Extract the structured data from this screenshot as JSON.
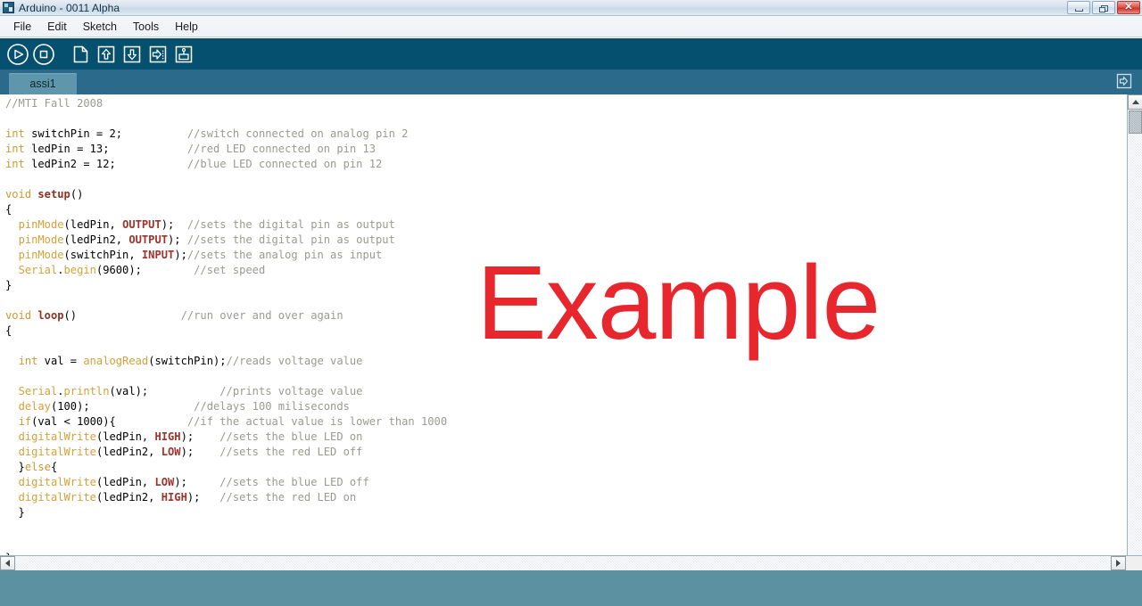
{
  "window": {
    "title": "Arduino - 0011 Alpha",
    "app_icon": "arduino-app-icon",
    "buttons": {
      "minimize": "minimize-button",
      "maximize": "restore-button",
      "close_glyph": "✕"
    }
  },
  "menubar": {
    "items": [
      {
        "label": "File"
      },
      {
        "label": "Edit"
      },
      {
        "label": "Sketch"
      },
      {
        "label": "Tools"
      },
      {
        "label": "Help"
      }
    ]
  },
  "toolbar": {
    "buttons": [
      {
        "name": "verify-run-button",
        "icon": "play-circle-icon"
      },
      {
        "name": "stop-button",
        "icon": "stop-circle-icon"
      },
      {
        "name": "new-button",
        "icon": "new-file-icon"
      },
      {
        "name": "open-button",
        "icon": "arrow-up-box-icon"
      },
      {
        "name": "save-button",
        "icon": "arrow-down-box-icon"
      },
      {
        "name": "upload-button",
        "icon": "arrow-right-dots-icon"
      },
      {
        "name": "serial-monitor-button",
        "icon": "serial-monitor-icon"
      }
    ]
  },
  "tabbar": {
    "tabs": [
      {
        "label": "assi1",
        "active": true
      }
    ],
    "menu_button": "tab-menu-icon"
  },
  "editor": {
    "watermark": {
      "text": "Example",
      "color": "#e8262d"
    },
    "colors": {
      "comment": "#9a9a92",
      "keyword": "#cc9a33",
      "function": "#d4a13a",
      "constant": "#a0332c",
      "plain": "#000000",
      "background": "#ffffff"
    },
    "lines": [
      {
        "tokens": [
          {
            "t": "//MTI Fall 2008",
            "k": "c"
          }
        ]
      },
      {
        "tokens": []
      },
      {
        "tokens": [
          {
            "t": "int",
            "k": "kw"
          },
          {
            "t": " switchPin = 2;",
            "k": "p"
          },
          {
            "t": "          ",
            "k": "p"
          },
          {
            "t": "//switch connected on analog pin 2",
            "k": "c"
          }
        ]
      },
      {
        "tokens": [
          {
            "t": "int",
            "k": "kw"
          },
          {
            "t": " ledPin = 13;",
            "k": "p"
          },
          {
            "t": "            ",
            "k": "p"
          },
          {
            "t": "//red LED connected on pin 13",
            "k": "c"
          }
        ]
      },
      {
        "tokens": [
          {
            "t": "int",
            "k": "kw"
          },
          {
            "t": " ledPin2 = 12;",
            "k": "p"
          },
          {
            "t": "           ",
            "k": "p"
          },
          {
            "t": "//blue LED connected on pin 12",
            "k": "c"
          }
        ]
      },
      {
        "tokens": []
      },
      {
        "tokens": [
          {
            "t": "void",
            "k": "kw"
          },
          {
            "t": " ",
            "k": "p"
          },
          {
            "t": "setup",
            "k": "fb"
          },
          {
            "t": "()",
            "k": "p"
          }
        ]
      },
      {
        "tokens": [
          {
            "t": "{",
            "k": "p"
          }
        ]
      },
      {
        "tokens": [
          {
            "t": "  ",
            "k": "p"
          },
          {
            "t": "pinMode",
            "k": "fn"
          },
          {
            "t": "(ledPin, ",
            "k": "p"
          },
          {
            "t": "OUTPUT",
            "k": "lit"
          },
          {
            "t": ");  ",
            "k": "p"
          },
          {
            "t": "//sets the digital pin as output",
            "k": "c"
          }
        ]
      },
      {
        "tokens": [
          {
            "t": "  ",
            "k": "p"
          },
          {
            "t": "pinMode",
            "k": "fn"
          },
          {
            "t": "(ledPin2, ",
            "k": "p"
          },
          {
            "t": "OUTPUT",
            "k": "lit"
          },
          {
            "t": "); ",
            "k": "p"
          },
          {
            "t": "//sets the digital pin as output",
            "k": "c"
          }
        ]
      },
      {
        "tokens": [
          {
            "t": "  ",
            "k": "p"
          },
          {
            "t": "pinMode",
            "k": "fn"
          },
          {
            "t": "(switchPin, ",
            "k": "p"
          },
          {
            "t": "INPUT",
            "k": "lit"
          },
          {
            "t": ");",
            "k": "p"
          },
          {
            "t": "//sets the analog pin as input",
            "k": "c"
          }
        ]
      },
      {
        "tokens": [
          {
            "t": "  ",
            "k": "p"
          },
          {
            "t": "Serial",
            "k": "fn"
          },
          {
            "t": ".",
            "k": "p"
          },
          {
            "t": "begin",
            "k": "fn"
          },
          {
            "t": "(9600);",
            "k": "p"
          },
          {
            "t": "        ",
            "k": "p"
          },
          {
            "t": "//set speed",
            "k": "c"
          }
        ]
      },
      {
        "tokens": [
          {
            "t": "}",
            "k": "p"
          }
        ]
      },
      {
        "tokens": []
      },
      {
        "tokens": [
          {
            "t": "void",
            "k": "kw"
          },
          {
            "t": " ",
            "k": "p"
          },
          {
            "t": "loop",
            "k": "fb"
          },
          {
            "t": "()",
            "k": "p"
          },
          {
            "t": "                ",
            "k": "p"
          },
          {
            "t": "//run over and over again",
            "k": "c"
          }
        ]
      },
      {
        "tokens": [
          {
            "t": "{",
            "k": "p"
          }
        ]
      },
      {
        "tokens": []
      },
      {
        "tokens": [
          {
            "t": "  ",
            "k": "p"
          },
          {
            "t": "int",
            "k": "kw"
          },
          {
            "t": " val = ",
            "k": "p"
          },
          {
            "t": "analogRead",
            "k": "fn"
          },
          {
            "t": "(switchPin);",
            "k": "p"
          },
          {
            "t": "//reads voltage value",
            "k": "c"
          }
        ]
      },
      {
        "tokens": []
      },
      {
        "tokens": [
          {
            "t": "  ",
            "k": "p"
          },
          {
            "t": "Serial",
            "k": "fn"
          },
          {
            "t": ".",
            "k": "p"
          },
          {
            "t": "println",
            "k": "fn"
          },
          {
            "t": "(val);",
            "k": "p"
          },
          {
            "t": "           ",
            "k": "p"
          },
          {
            "t": "//prints voltage value",
            "k": "c"
          }
        ]
      },
      {
        "tokens": [
          {
            "t": "  ",
            "k": "p"
          },
          {
            "t": "delay",
            "k": "fn"
          },
          {
            "t": "(100);",
            "k": "p"
          },
          {
            "t": "                ",
            "k": "p"
          },
          {
            "t": "//delays 100 miliseconds",
            "k": "c"
          }
        ]
      },
      {
        "tokens": [
          {
            "t": "  ",
            "k": "p"
          },
          {
            "t": "if",
            "k": "kw"
          },
          {
            "t": "(val < 1000){",
            "k": "p"
          },
          {
            "t": "           ",
            "k": "p"
          },
          {
            "t": "//if the actual value is lower than 1000",
            "k": "c"
          }
        ]
      },
      {
        "tokens": [
          {
            "t": "  ",
            "k": "p"
          },
          {
            "t": "digitalWrite",
            "k": "fn"
          },
          {
            "t": "(ledPin, ",
            "k": "p"
          },
          {
            "t": "HIGH",
            "k": "lit"
          },
          {
            "t": ");",
            "k": "p"
          },
          {
            "t": "    ",
            "k": "p"
          },
          {
            "t": "//sets the blue LED on",
            "k": "c"
          }
        ]
      },
      {
        "tokens": [
          {
            "t": "  ",
            "k": "p"
          },
          {
            "t": "digitalWrite",
            "k": "fn"
          },
          {
            "t": "(ledPin2, ",
            "k": "p"
          },
          {
            "t": "LOW",
            "k": "lit"
          },
          {
            "t": ");",
            "k": "p"
          },
          {
            "t": "    ",
            "k": "p"
          },
          {
            "t": "//sets the red LED off",
            "k": "c"
          }
        ]
      },
      {
        "tokens": [
          {
            "t": "  }",
            "k": "p"
          },
          {
            "t": "else",
            "k": "kw"
          },
          {
            "t": "{",
            "k": "p"
          }
        ]
      },
      {
        "tokens": [
          {
            "t": "  ",
            "k": "p"
          },
          {
            "t": "digitalWrite",
            "k": "fn"
          },
          {
            "t": "(ledPin, ",
            "k": "p"
          },
          {
            "t": "LOW",
            "k": "lit"
          },
          {
            "t": ");",
            "k": "p"
          },
          {
            "t": "     ",
            "k": "p"
          },
          {
            "t": "//sets the blue LED off",
            "k": "c"
          }
        ]
      },
      {
        "tokens": [
          {
            "t": "  ",
            "k": "p"
          },
          {
            "t": "digitalWrite",
            "k": "fn"
          },
          {
            "t": "(ledPin2, ",
            "k": "p"
          },
          {
            "t": "HIGH",
            "k": "lit"
          },
          {
            "t": ");",
            "k": "p"
          },
          {
            "t": "   ",
            "k": "p"
          },
          {
            "t": "//sets the red LED on",
            "k": "c"
          }
        ]
      },
      {
        "tokens": [
          {
            "t": "  }",
            "k": "p"
          }
        ]
      },
      {
        "tokens": []
      },
      {
        "tokens": []
      },
      {
        "tokens": [
          {
            "t": "}",
            "k": "p"
          }
        ]
      }
    ]
  },
  "scrollbars": {
    "vertical": {
      "up_arrow": "scroll-up-arrow",
      "thumb": "vertical-scroll-thumb"
    },
    "horizontal": {
      "left_arrow": "scroll-left-arrow",
      "right_arrow": "scroll-right-arrow"
    }
  },
  "statusbar": {
    "text": ""
  }
}
